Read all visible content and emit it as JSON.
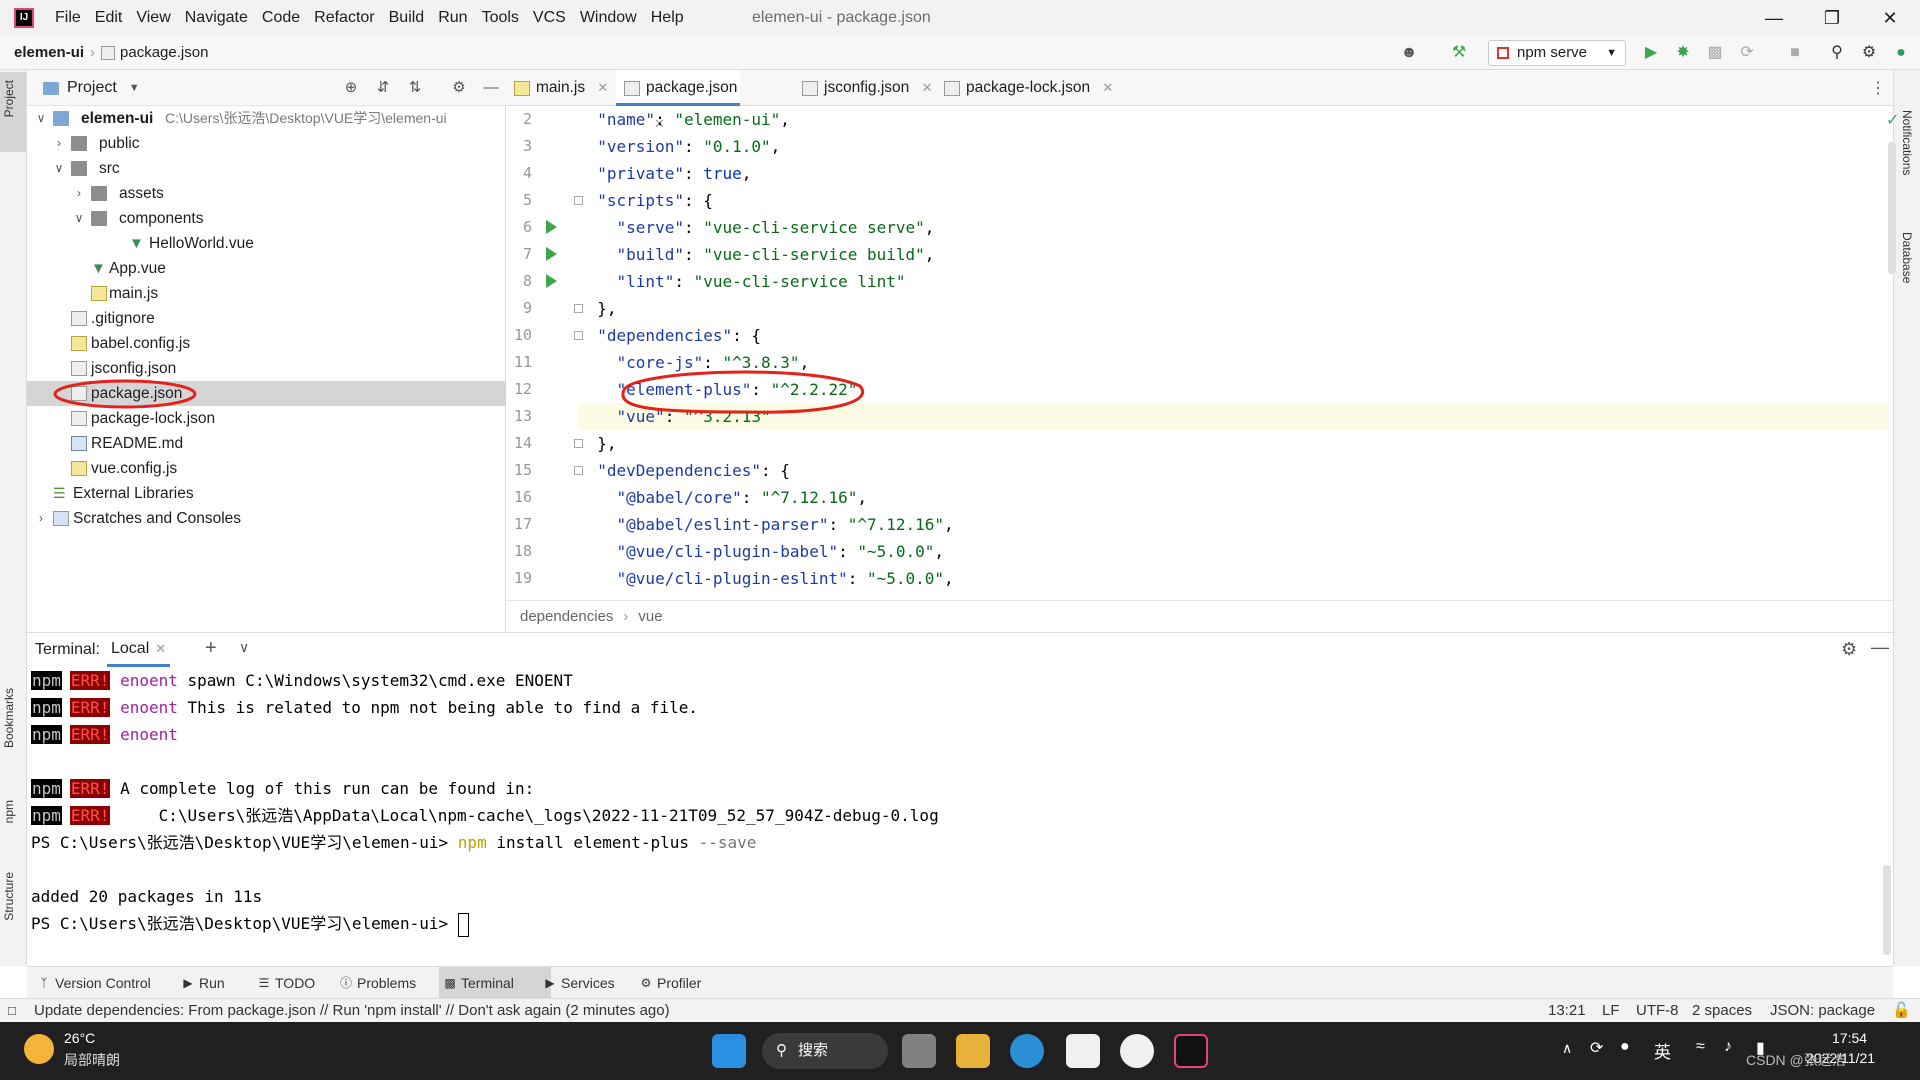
{
  "menubar": {
    "items": [
      "File",
      "Edit",
      "View",
      "Navigate",
      "Code",
      "Refactor",
      "Build",
      "Run",
      "Tools",
      "VCS",
      "Window",
      "Help"
    ],
    "window_title": "elemen-ui - package.json",
    "app_logo": "IJ"
  },
  "navbar": {
    "project": "elemen-ui",
    "file": "package.json",
    "run_config": "npm serve"
  },
  "left_strip": {
    "project": "Project",
    "bookmarks": "Bookmarks",
    "npm": "npm",
    "structure": "Structure"
  },
  "right_strip": {
    "notifications": "Notifications",
    "database": "Database"
  },
  "project_panel": {
    "title": "Project",
    "tree": [
      {
        "label": "elemen-ui",
        "path": "C:\\Users\\张远浩\\Desktop\\VUE学习\\elemen-ui"
      },
      {
        "label": "public"
      },
      {
        "label": "src"
      },
      {
        "label": "assets"
      },
      {
        "label": "components"
      },
      {
        "label": "HelloWorld.vue"
      },
      {
        "label": "App.vue"
      },
      {
        "label": "main.js"
      },
      {
        "label": ".gitignore"
      },
      {
        "label": "babel.config.js"
      },
      {
        "label": "jsconfig.json"
      },
      {
        "label": "package.json"
      },
      {
        "label": "package-lock.json"
      },
      {
        "label": "README.md"
      },
      {
        "label": "vue.config.js"
      },
      {
        "label": "External Libraries"
      },
      {
        "label": "Scratches and Consoles"
      }
    ]
  },
  "editor": {
    "tabs": [
      "main.js",
      "package.json",
      "jsconfig.json",
      "package-lock.json"
    ],
    "line_numbers": [
      "2",
      "3",
      "4",
      "5",
      "6",
      "7",
      "8",
      "9",
      "10",
      "11",
      "12",
      "13",
      "14",
      "15",
      "16",
      "17",
      "18",
      "19"
    ],
    "lines": [
      {
        "key": "\"name\"",
        "sep": ": ",
        "val": "\"elemen-ui\"",
        "end": ","
      },
      {
        "key": "\"version\"",
        "sep": ": ",
        "val": "\"0.1.0\"",
        "end": ","
      },
      {
        "key": "\"private\"",
        "sep": ": ",
        "val": "true",
        "end": ","
      },
      {
        "key": "\"scripts\"",
        "sep": ": ",
        "val": "",
        "end": "{"
      },
      {
        "key": "\"serve\"",
        "sep": ": ",
        "val": "\"vue-cli-service serve\"",
        "end": ","
      },
      {
        "key": "\"build\"",
        "sep": ": ",
        "val": "\"vue-cli-service build\"",
        "end": ","
      },
      {
        "key": "\"lint\"",
        "sep": ": ",
        "val": "\"vue-cli-service lint\"",
        "end": ""
      },
      {
        "key": "",
        "sep": "",
        "val": "",
        "end": "},"
      },
      {
        "key": "\"dependencies\"",
        "sep": ": ",
        "val": "",
        "end": "{"
      },
      {
        "key": "\"core-js\"",
        "sep": ": ",
        "val": "\"^3.8.3\"",
        "end": ","
      },
      {
        "key": "\"element-plus\"",
        "sep": ": ",
        "val": "\"^2.2.22\"",
        "end": ","
      },
      {
        "key": "\"vue\"",
        "sep": ": ",
        "val": "\"^3.2.13\"",
        "end": ""
      },
      {
        "key": "",
        "sep": "",
        "val": "",
        "end": "},"
      },
      {
        "key": "\"devDependencies\"",
        "sep": ": ",
        "val": "",
        "end": "{"
      },
      {
        "key": "\"@babel/core\"",
        "sep": ": ",
        "val": "\"^7.12.16\"",
        "end": ","
      },
      {
        "key": "\"@babel/eslint-parser\"",
        "sep": ": ",
        "val": "\"^7.12.16\"",
        "end": ","
      },
      {
        "key": "\"@vue/cli-plugin-babel\"",
        "sep": ": ",
        "val": "\"~5.0.0\"",
        "end": ","
      },
      {
        "key": "\"@vue/cli-plugin-eslint\"",
        "sep": ": ",
        "val": "\"~5.0.0\"",
        "end": ","
      }
    ],
    "breadcrumb": [
      "dependencies",
      "vue"
    ]
  },
  "terminal": {
    "label": "Terminal:",
    "tab": "Local",
    "npm_tag": "npm",
    "err_tag": "ERR!",
    "lines": {
      "l1_word": "enoent",
      "l1_rest": " spawn C:\\Windows\\system32\\cmd.exe ENOENT",
      "l2_word": "enoent",
      "l2_rest": " This is related to npm not being able to find a file.",
      "l3_word": "enoent",
      "l4": " A complete log of this run can be found in:",
      "l5": "     C:\\Users\\张远浩\\AppData\\Local\\npm-cache\\_logs\\2022-11-21T09_52_57_904Z-debug-0.log",
      "ps_prompt": "PS C:\\Users\\张远浩\\Desktop\\VUE学习\\elemen-ui> ",
      "cmd_npm": "npm",
      "cmd_rest": " install element-plus ",
      "cmd_flag": "--save",
      "added": "added 20 packages in 11s",
      "ps_prompt2": "PS C:\\Users\\张远浩\\Desktop\\VUE学习\\elemen-ui> "
    }
  },
  "toolwindows": [
    "Version Control",
    "Run",
    "TODO",
    "Problems",
    "Terminal",
    "Services",
    "Profiler"
  ],
  "statusbar": {
    "message": "Update dependencies: From package.json // Run 'npm install' // Don't ask again (2 minutes ago)",
    "position": "13:21",
    "line_sep": "LF",
    "encoding": "UTF-8",
    "indent": "2 spaces",
    "filetype": "JSON: package"
  },
  "taskbar": {
    "temp": "26°C",
    "weather": "局部晴朗",
    "search": "搜索",
    "ime": "英",
    "time": "17:54",
    "date": "2022/11/21",
    "watermark": "CSDN @张远浩"
  },
  "colors": {
    "accent": "#4083c9",
    "annotation": "#e3231b",
    "run_green": "#3fa54b"
  }
}
